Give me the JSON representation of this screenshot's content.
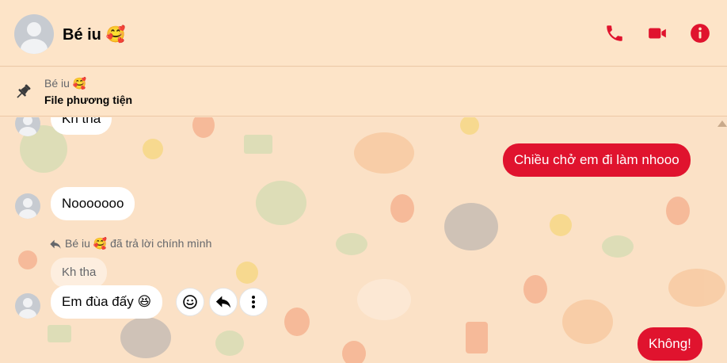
{
  "header": {
    "contact_name": "Bé iu 🥰",
    "icons": {
      "call": "phone-icon",
      "video": "video-camera-icon",
      "info": "info-icon"
    },
    "accent_color": "#e0132e"
  },
  "pinned": {
    "icon": "pin-icon",
    "sender": "Bé iu 🥰",
    "title": "File phương tiện"
  },
  "messages": [
    {
      "side": "in",
      "text": "Kh tha"
    },
    {
      "side": "out",
      "text": "Chiều chở em đi làm nhooo"
    },
    {
      "side": "in",
      "text": "Nooooooo"
    },
    {
      "side": "in",
      "text": "Em đùa đấy 😆",
      "reply": {
        "meta": "Bé iu 🥰 đã trả lời chính mình",
        "quoted": "Kh tha"
      }
    },
    {
      "side": "out",
      "text": "Không!"
    }
  ],
  "message_actions": [
    "react-icon",
    "reply-icon",
    "more-options-icon"
  ]
}
